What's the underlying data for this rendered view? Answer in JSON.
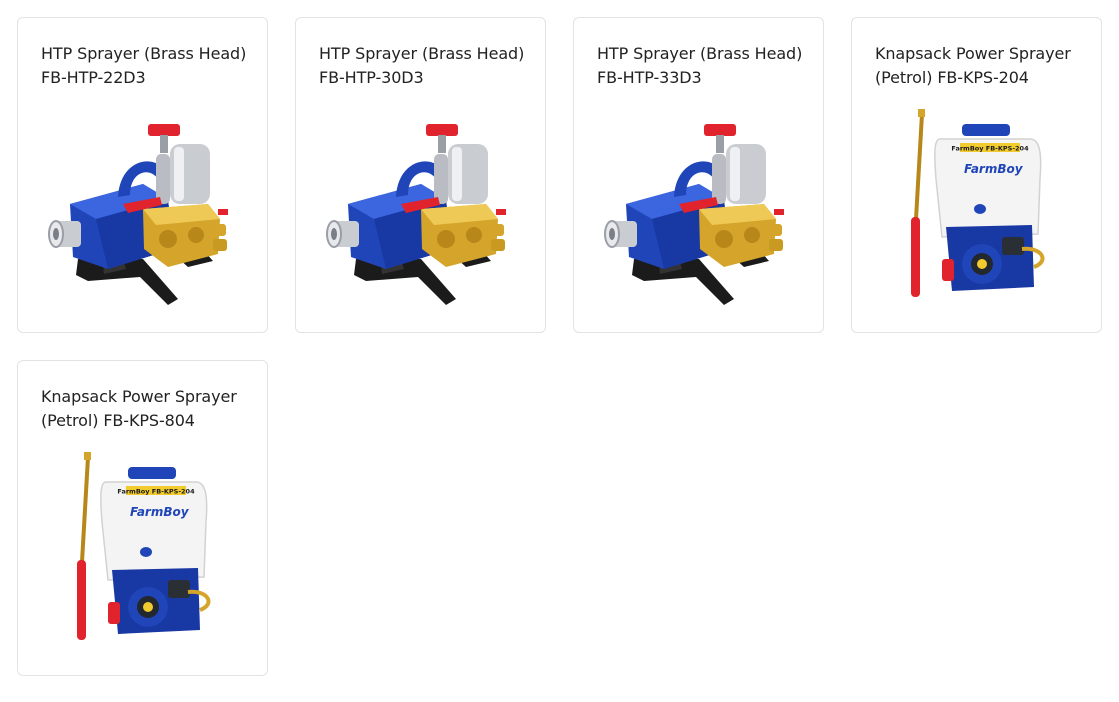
{
  "products": [
    {
      "title": "HTP Sprayer (Brass Head) FB-HTP-22D3",
      "image": "htp-pump-sprayer"
    },
    {
      "title": "HTP Sprayer (Brass Head) FB-HTP-30D3",
      "image": "htp-pump-sprayer"
    },
    {
      "title": "HTP Sprayer (Brass Head) FB-HTP-33D3",
      "image": "htp-pump-sprayer"
    },
    {
      "title": "Knapsack Power Sprayer (Petrol) FB-KPS-204",
      "image": "knapsack-power-sprayer"
    },
    {
      "title": "Knapsack Power Sprayer (Petrol) FB-KPS-804",
      "image": "knapsack-power-sprayer"
    }
  ],
  "brand": {
    "logo_text": "FarmBoy",
    "label_text": "FarmBoy FB-KPS-204"
  },
  "colors": {
    "pump_blue": "#1f45b8",
    "brass": "#d4a52a",
    "steel": "#c9ccd1",
    "handle_red": "#e0232c",
    "tank_white": "#f4f4f4",
    "bracket_black": "#1b1b1b",
    "card_border": "#e3e3e3"
  }
}
